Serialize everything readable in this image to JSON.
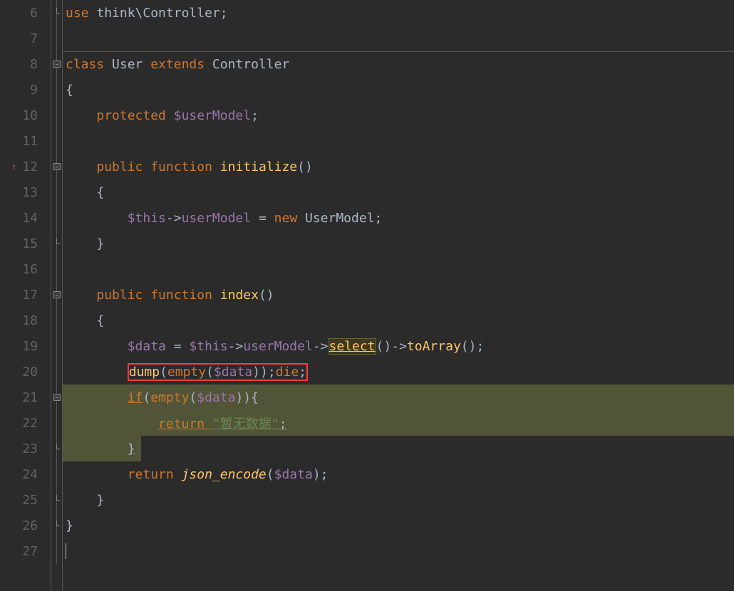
{
  "lines": [
    {
      "num": "6",
      "fold": "close"
    },
    {
      "num": "7",
      "fold": "line"
    },
    {
      "num": "8",
      "fold": "open"
    },
    {
      "num": "9",
      "fold": "line"
    },
    {
      "num": "10",
      "fold": "line"
    },
    {
      "num": "11",
      "fold": "line"
    },
    {
      "num": "12",
      "fold": "open",
      "marker": true
    },
    {
      "num": "13",
      "fold": "line"
    },
    {
      "num": "14",
      "fold": "line"
    },
    {
      "num": "15",
      "fold": "close"
    },
    {
      "num": "16",
      "fold": "line"
    },
    {
      "num": "17",
      "fold": "open"
    },
    {
      "num": "18",
      "fold": "line"
    },
    {
      "num": "19",
      "fold": "line"
    },
    {
      "num": "20",
      "fold": "line"
    },
    {
      "num": "21",
      "fold": "open"
    },
    {
      "num": "22",
      "fold": "line"
    },
    {
      "num": "23",
      "fold": "close"
    },
    {
      "num": "24",
      "fold": "line"
    },
    {
      "num": "25",
      "fold": "close"
    },
    {
      "num": "26",
      "fold": "close"
    },
    {
      "num": "27",
      "fold": "line"
    }
  ],
  "code": {
    "l6": {
      "use": "use ",
      "ns": "think\\Controller",
      "semi": ";"
    },
    "l8": {
      "class": "class ",
      "name": "User ",
      "extends": "extends ",
      "parent": "Controller"
    },
    "l9": {
      "brace": "{"
    },
    "l10": {
      "pad": "    ",
      "protected": "protected ",
      "var": "$userModel",
      "semi": ";"
    },
    "l12": {
      "pad": "    ",
      "public": "public ",
      "function": "function ",
      "name": "initialize",
      "parens": "()"
    },
    "l13": {
      "pad": "    ",
      "brace": "{"
    },
    "l14": {
      "pad": "        ",
      "this": "$this",
      "arrow": "->",
      "prop": "userModel",
      "eq": " = ",
      "new": "new ",
      "cls": "UserModel",
      "semi": ";"
    },
    "l15": {
      "pad": "    ",
      "brace": "}"
    },
    "l17": {
      "pad": "    ",
      "public": "public ",
      "function": "function ",
      "name": "index",
      "parens": "()"
    },
    "l18": {
      "pad": "    ",
      "brace": "{"
    },
    "l19": {
      "pad": "        ",
      "var": "$data",
      "eq": " = ",
      "this": "$this",
      "arrow1": "->",
      "prop": "userModel",
      "arrow2": "->",
      "select": "select",
      "p1": "()",
      "arrow3": "->",
      "toArray": "toArray",
      "p2": "()",
      "semi": ";"
    },
    "l20": {
      "pad": "        ",
      "dump": "dump",
      "p1": "(",
      "empty": "empty",
      "p2": "(",
      "var": "$data",
      "p3": "))",
      "semi1": ";",
      "die": "die",
      "semi2": ";"
    },
    "l21": {
      "pad": "        ",
      "if": "if",
      "p1": "(",
      "empty": "empty",
      "p2": "(",
      "var": "$data",
      "p3": ")){"
    },
    "l22": {
      "pad": "            ",
      "return": "return ",
      "str": "\"暂无数据\"",
      "semi": ";"
    },
    "l23": {
      "pad": "        ",
      "brace": "}"
    },
    "l24": {
      "pad": "        ",
      "return": "return ",
      "func": "json_encode",
      "p1": "(",
      "var": "$data",
      "p2": ")",
      "semi": ";"
    },
    "l25": {
      "pad": "    ",
      "brace": "}"
    },
    "l26": {
      "brace": "}"
    }
  }
}
